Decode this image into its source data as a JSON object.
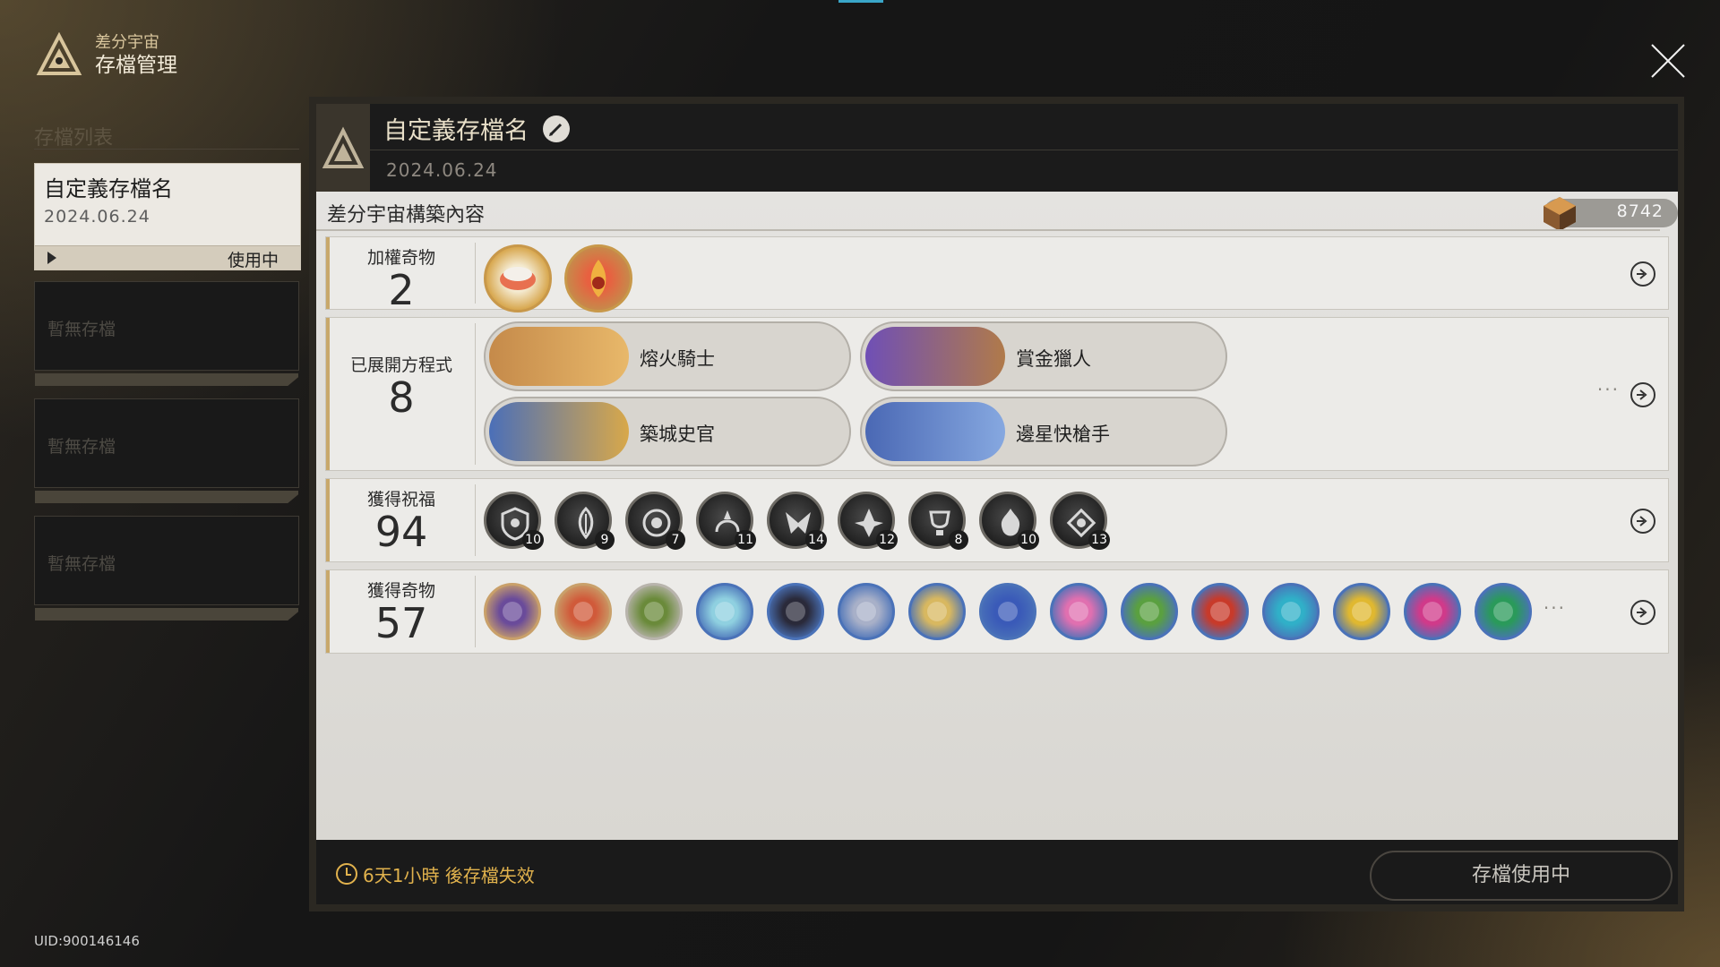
{
  "header": {
    "subtitle": "差分宇宙",
    "title": "存檔管理"
  },
  "sidebar": {
    "title": "存檔列表",
    "active_slot": {
      "name": "自定義存檔名",
      "date": "2024.06.24",
      "status": "使用中"
    },
    "empty_slots": [
      "暫無存檔",
      "暫無存檔",
      "暫無存檔"
    ]
  },
  "uid": "UID:900146146",
  "save": {
    "name": "自定義存檔名",
    "date": "2024.06.24",
    "section_title": "差分宇宙構築內容",
    "score": "8742"
  },
  "weighted_curios": {
    "label": "加權奇物",
    "count": "2"
  },
  "equations": {
    "label": "已展開方程式",
    "count": "8",
    "items": [
      {
        "name": "熔火騎士",
        "colors": [
          "#c58a4a",
          "#e8b86a"
        ]
      },
      {
        "name": "賞金獵人",
        "colors": [
          "#6f4fb6",
          "#b07a4a"
        ]
      },
      {
        "name": "築城史官",
        "colors": [
          "#4b6fb8",
          "#d8a84a"
        ]
      },
      {
        "name": "邊星快槍手",
        "colors": [
          "#4a68b4",
          "#86a8e0"
        ]
      }
    ]
  },
  "blessings": {
    "label": "獲得祝福",
    "count": "94",
    "items": [
      {
        "icon": "preservation-icon",
        "count": "10"
      },
      {
        "icon": "remembrance-icon",
        "count": "9"
      },
      {
        "icon": "nihility-icon",
        "count": "7"
      },
      {
        "icon": "abundance-icon",
        "count": "11"
      },
      {
        "icon": "the-hunt-icon",
        "count": "14"
      },
      {
        "icon": "destruction-icon",
        "count": "12"
      },
      {
        "icon": "elation-icon",
        "count": "8"
      },
      {
        "icon": "propagation-icon",
        "count": "10"
      },
      {
        "icon": "erudition-icon",
        "count": "13"
      }
    ]
  },
  "curios": {
    "label": "獲得奇物",
    "count": "57",
    "items": [
      {
        "icon": "curio-cloak-icon",
        "color": "#6a4b9a",
        "ring": "#c9a06a"
      },
      {
        "icon": "curio-rope-icon",
        "color": "#d05a3a",
        "ring": "#c9a06a"
      },
      {
        "icon": "curio-stone-icon",
        "color": "#6a8a3a",
        "ring": "#b8b4ac"
      },
      {
        "icon": "curio-orb-icon",
        "color": "#8fd0e0",
        "ring": "#4a72b8"
      },
      {
        "icon": "curio-triangle-icon",
        "color": "#2a2a3a",
        "ring": "#4a72b8"
      },
      {
        "icon": "curio-tube-icon",
        "color": "#a8b0c8",
        "ring": "#4a72b8"
      },
      {
        "icon": "curio-coins-icon",
        "color": "#d8b860",
        "ring": "#4a72b8"
      },
      {
        "icon": "curio-blue-gem-icon",
        "color": "#3a5ab8",
        "ring": "#4a72b8"
      },
      {
        "icon": "curio-pink-gem-icon",
        "color": "#e070b0",
        "ring": "#4a72b8"
      },
      {
        "icon": "curio-green-gem-icon",
        "color": "#5aa040",
        "ring": "#4a72b8"
      },
      {
        "icon": "curio-red-gem-icon",
        "color": "#c83a2a",
        "ring": "#4a72b8"
      },
      {
        "icon": "curio-cyan-gem-icon",
        "color": "#30b0c8",
        "ring": "#4a72b8"
      },
      {
        "icon": "curio-gold-gem-icon",
        "color": "#e0b830",
        "ring": "#4a72b8"
      },
      {
        "icon": "curio-magenta-gem-icon",
        "color": "#d03a8a",
        "ring": "#4a72b8"
      },
      {
        "icon": "curio-emerald-gem-icon",
        "color": "#2a9a5a",
        "ring": "#4a72b8"
      }
    ]
  },
  "footer": {
    "expire_text": "6天1小時 後存檔失效",
    "button_label": "存檔使用中"
  },
  "colors": {
    "accent": "#e1b24d",
    "gold": "#c8a86b",
    "panel": "#1b1b1b"
  }
}
